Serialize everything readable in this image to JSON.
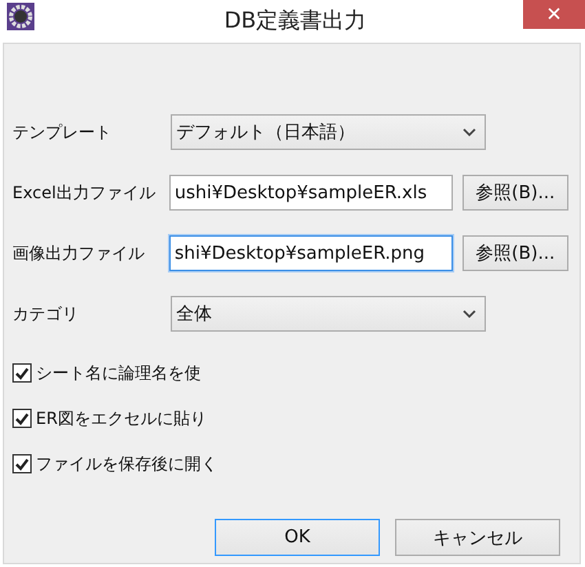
{
  "window": {
    "title": "DB定義書出力",
    "close": "✕"
  },
  "fields": [
    {
      "kind": "combo",
      "label": "テンプレート",
      "value": "デフォルト（日本語）"
    },
    {
      "kind": "file",
      "label": "Excel出力ファイル",
      "value": "ushi¥Desktop¥sampleER.xls",
      "button": "参照(B)...",
      "focused": false
    },
    {
      "kind": "file",
      "label": "画像出力ファイル",
      "value": "shi¥Desktop¥sampleER.png",
      "button": "参照(B)...",
      "focused": true
    },
    {
      "kind": "combo",
      "label": "カテゴリ",
      "value": "全体"
    }
  ],
  "checkboxes": [
    {
      "label": "シート名に論理名を使",
      "checked": true
    },
    {
      "label": "ER図をエクセルに貼り",
      "checked": true
    },
    {
      "label": "ファイルを保存後に開く",
      "checked": true
    }
  ],
  "buttons": [
    {
      "label": "OK",
      "selected": true
    },
    {
      "label": "キャンセル",
      "selected": false
    }
  ]
}
